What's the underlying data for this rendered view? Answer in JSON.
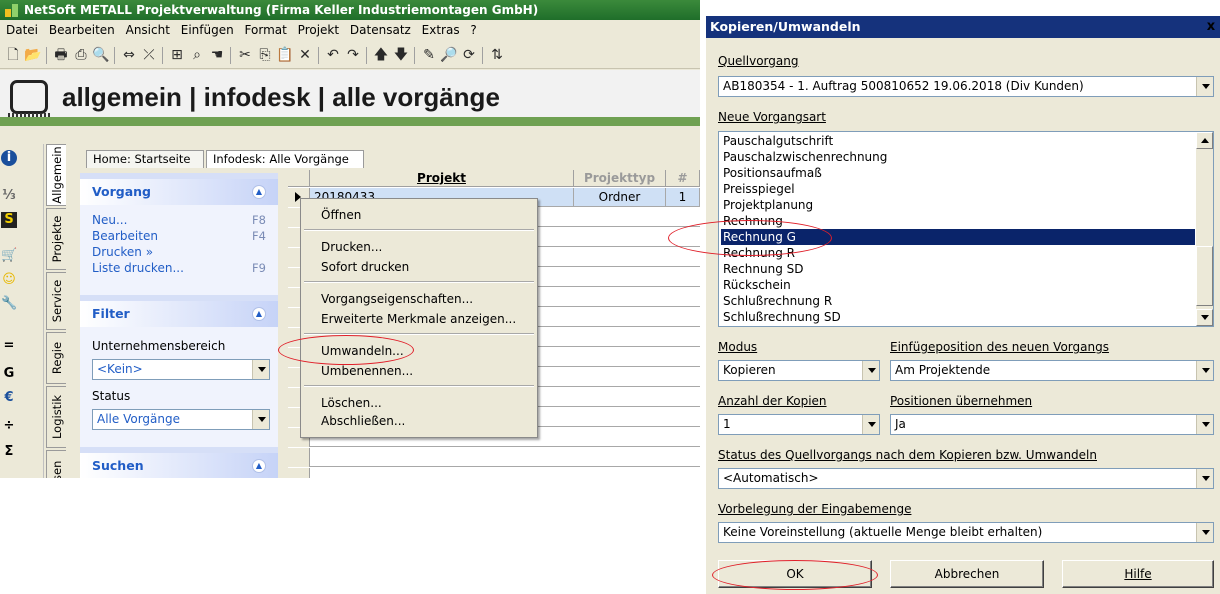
{
  "app": {
    "title": "NetSoft METALL Projektverwaltung (Firma Keller Industriemontagen GmbH)",
    "menu": [
      "Datei",
      "Bearbeiten",
      "Ansicht",
      "Einfügen",
      "Format",
      "Projekt",
      "Datensatz",
      "Extras",
      "?"
    ],
    "header_title": "allgemein | infodesk | alle vorgänge",
    "brand_color": "#6fa152"
  },
  "vertical_tabs": [
    "Allgemein",
    "Projekte",
    "Service",
    "Regie",
    "Logistik",
    "Kassen"
  ],
  "left_icons": [
    "info-icon",
    "calculator-icon",
    "s-icon",
    "cart-icon",
    "smiley-icon",
    "wrench-icon",
    "equals-icon",
    "g-icon",
    "euro-icon",
    "divide-icon",
    "sum-icon"
  ],
  "tabs": [
    {
      "label": "Home: Startseite"
    },
    {
      "label": "Infodesk: Alle Vorgänge",
      "close": "×"
    }
  ],
  "taskpane": {
    "vorgang": {
      "title": "Vorgang",
      "links": [
        {
          "label": "Neu...",
          "key": "F8"
        },
        {
          "label": "Bearbeiten",
          "key": "F4"
        },
        {
          "label": "Drucken »",
          "key": ""
        },
        {
          "label": "Liste drucken...",
          "key": "F9"
        }
      ]
    },
    "filter": {
      "title": "Filter",
      "unternehmensbereich_label": "Unternehmensbereich",
      "unternehmensbereich_value": "<Kein>",
      "status_label": "Status",
      "status_value": "Alle Vorgänge"
    },
    "suchen": {
      "title": "Suchen"
    }
  },
  "grid": {
    "columns": [
      "Projekt",
      "Projekttyp",
      "#"
    ],
    "rows": [
      {
        "projekt": "20180433",
        "projekttyp": "Ordner",
        "nr": "1"
      }
    ]
  },
  "context_menu": {
    "groups": [
      [
        "Öffnen"
      ],
      [
        "Drucken...",
        "Sofort drucken"
      ],
      [
        "Vorgangseigenschaften...",
        "Erweiterte Merkmale anzeigen..."
      ],
      [
        "Umwandeln...",
        "Umbenennen..."
      ],
      [
        "Löschen...",
        "Abschließen..."
      ]
    ]
  },
  "dialog": {
    "title": "Kopieren/Umwandeln",
    "close": "x",
    "quellvorgang_label": "Quellvorgang",
    "quellvorgang_value": "AB180354 - 1. Auftrag 500810652 19.06.2018 (Div Kunden)",
    "vorgangsart_label": "Neue Vorgangsart",
    "vorgangsart_items": [
      "Pauschalgutschrift",
      "Pauschalzwischenrechnung",
      "Positionsaufmaß",
      "Preisspiegel",
      "Projektplanung",
      "Rechnung",
      "Rechnung G",
      "Rechnung R",
      "Rechnung SD",
      "Rückschein",
      "Schlußrechnung R",
      "Schlußrechnung SD"
    ],
    "vorgangsart_selected": "Rechnung G",
    "modus_label": "Modus",
    "modus_value": "Kopieren",
    "einfuege_label": "Einfügeposition des neuen Vorgangs",
    "einfuege_value": "Am Projektende",
    "anzahl_label": "Anzahl der Kopien",
    "anzahl_value": "1",
    "positionen_label": "Positionen übernehmen",
    "positionen_value": "Ja",
    "status_label": "Status des Quellvorgangs nach dem Kopieren bzw. Umwandeln",
    "status_value": "<Automatisch>",
    "vorbelegung_label": "Vorbelegung der Eingabemenge",
    "vorbelegung_value": "Keine Voreinstellung (aktuelle Menge bleibt erhalten)",
    "ok_label": "OK",
    "cancel_label": "Abbrechen",
    "help_label": "Hilfe",
    "selection_color": "#0a246a"
  },
  "annotation_color": "#e0202a"
}
